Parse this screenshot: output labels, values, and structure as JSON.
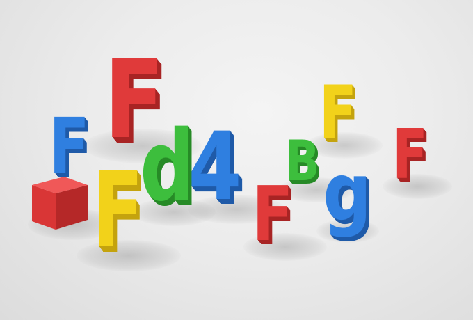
{
  "scene": {
    "background_color": "#ececec",
    "palette": {
      "red": "#e03a3a",
      "red_side": "#a82424",
      "blue": "#2f7fe0",
      "blue_side": "#1f5aa8",
      "yellow": "#f2d21a",
      "yellow_side": "#c4a30e",
      "green": "#3dbe3d",
      "green_side": "#278a27"
    },
    "glyphs": [
      {
        "name": "red-F-large",
        "char": "F",
        "color": "red"
      },
      {
        "name": "blue-F-left",
        "char": "F",
        "color": "blue"
      },
      {
        "name": "yellow-F-front",
        "char": "F",
        "color": "yellow"
      },
      {
        "name": "green-d",
        "char": "d",
        "color": "green"
      },
      {
        "name": "blue-4",
        "char": "4",
        "color": "blue"
      },
      {
        "name": "red-F-center",
        "char": "F",
        "color": "red"
      },
      {
        "name": "green-B",
        "char": "B",
        "color": "green"
      },
      {
        "name": "yellow-F-right",
        "char": "F",
        "color": "yellow"
      },
      {
        "name": "blue-g",
        "char": "g",
        "color": "blue"
      },
      {
        "name": "red-F-right",
        "char": "F",
        "color": "red"
      }
    ],
    "objects": [
      {
        "name": "red-cube",
        "color": "red"
      }
    ]
  }
}
